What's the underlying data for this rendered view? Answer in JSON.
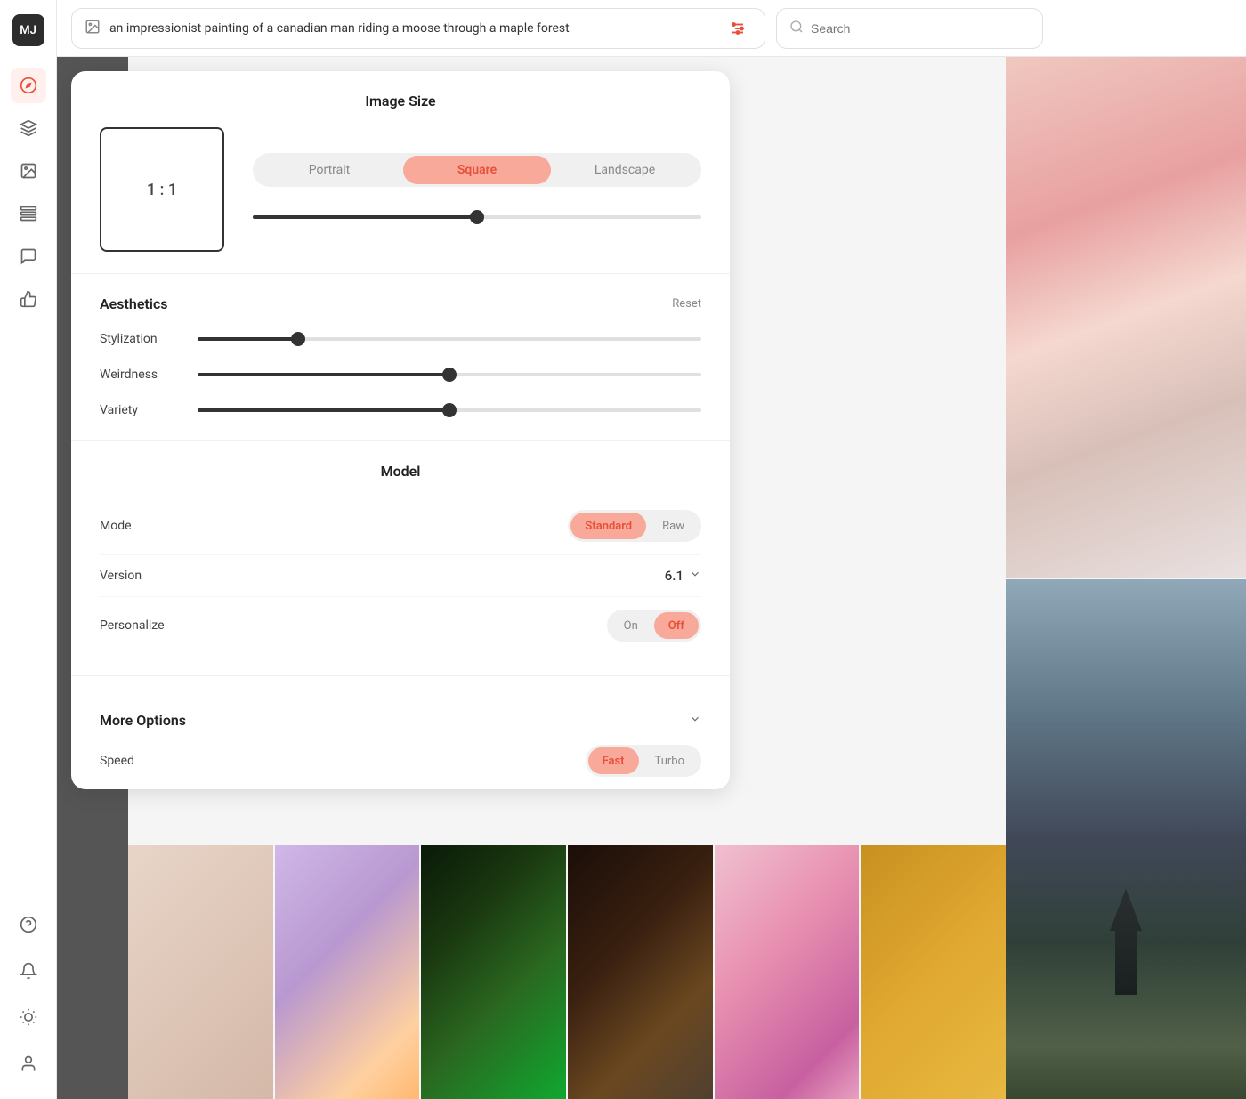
{
  "sidebar": {
    "avatar": "MJ",
    "items": [
      {
        "id": "compass",
        "icon": "⊕",
        "active": true
      },
      {
        "id": "brush",
        "icon": "🖌"
      },
      {
        "id": "image",
        "icon": "🖼"
      },
      {
        "id": "layers",
        "icon": "📋"
      },
      {
        "id": "chat",
        "icon": "💬"
      },
      {
        "id": "thumbsup",
        "icon": "👍"
      }
    ],
    "bottom_items": [
      {
        "id": "help",
        "icon": "?"
      },
      {
        "id": "bell",
        "icon": "🔔"
      },
      {
        "id": "settings",
        "icon": "✦"
      },
      {
        "id": "profile",
        "icon": "👤"
      }
    ]
  },
  "header": {
    "prompt": "an impressionist painting of a canadian man riding a moose through a maple forest",
    "filter_icon": "≡",
    "search_placeholder": "Search"
  },
  "image_size": {
    "title": "Image Size",
    "aspect_ratio": "1 : 1",
    "orientations": [
      "Portrait",
      "Square",
      "Landscape"
    ],
    "active_orientation": "Square",
    "slider_percent": 50
  },
  "aesthetics": {
    "title": "Aesthetics",
    "reset_label": "Reset",
    "sliders": [
      {
        "label": "Stylization",
        "value": 20
      },
      {
        "label": "Weirdness",
        "value": 50
      },
      {
        "label": "Variety",
        "value": 50
      }
    ]
  },
  "model": {
    "title": "Model",
    "rows": [
      {
        "label": "Mode",
        "type": "toggle",
        "options": [
          "Standard",
          "Raw"
        ],
        "active": "Standard"
      },
      {
        "label": "Version",
        "type": "select",
        "value": "6.1"
      },
      {
        "label": "Personalize",
        "type": "toggle",
        "options": [
          "On",
          "Off"
        ],
        "active": "Off"
      }
    ]
  },
  "more_options": {
    "title": "More Options",
    "rows": [
      {
        "label": "Speed",
        "type": "toggle",
        "options": [
          "Fast",
          "Turbo"
        ],
        "active": "Fast"
      }
    ]
  }
}
